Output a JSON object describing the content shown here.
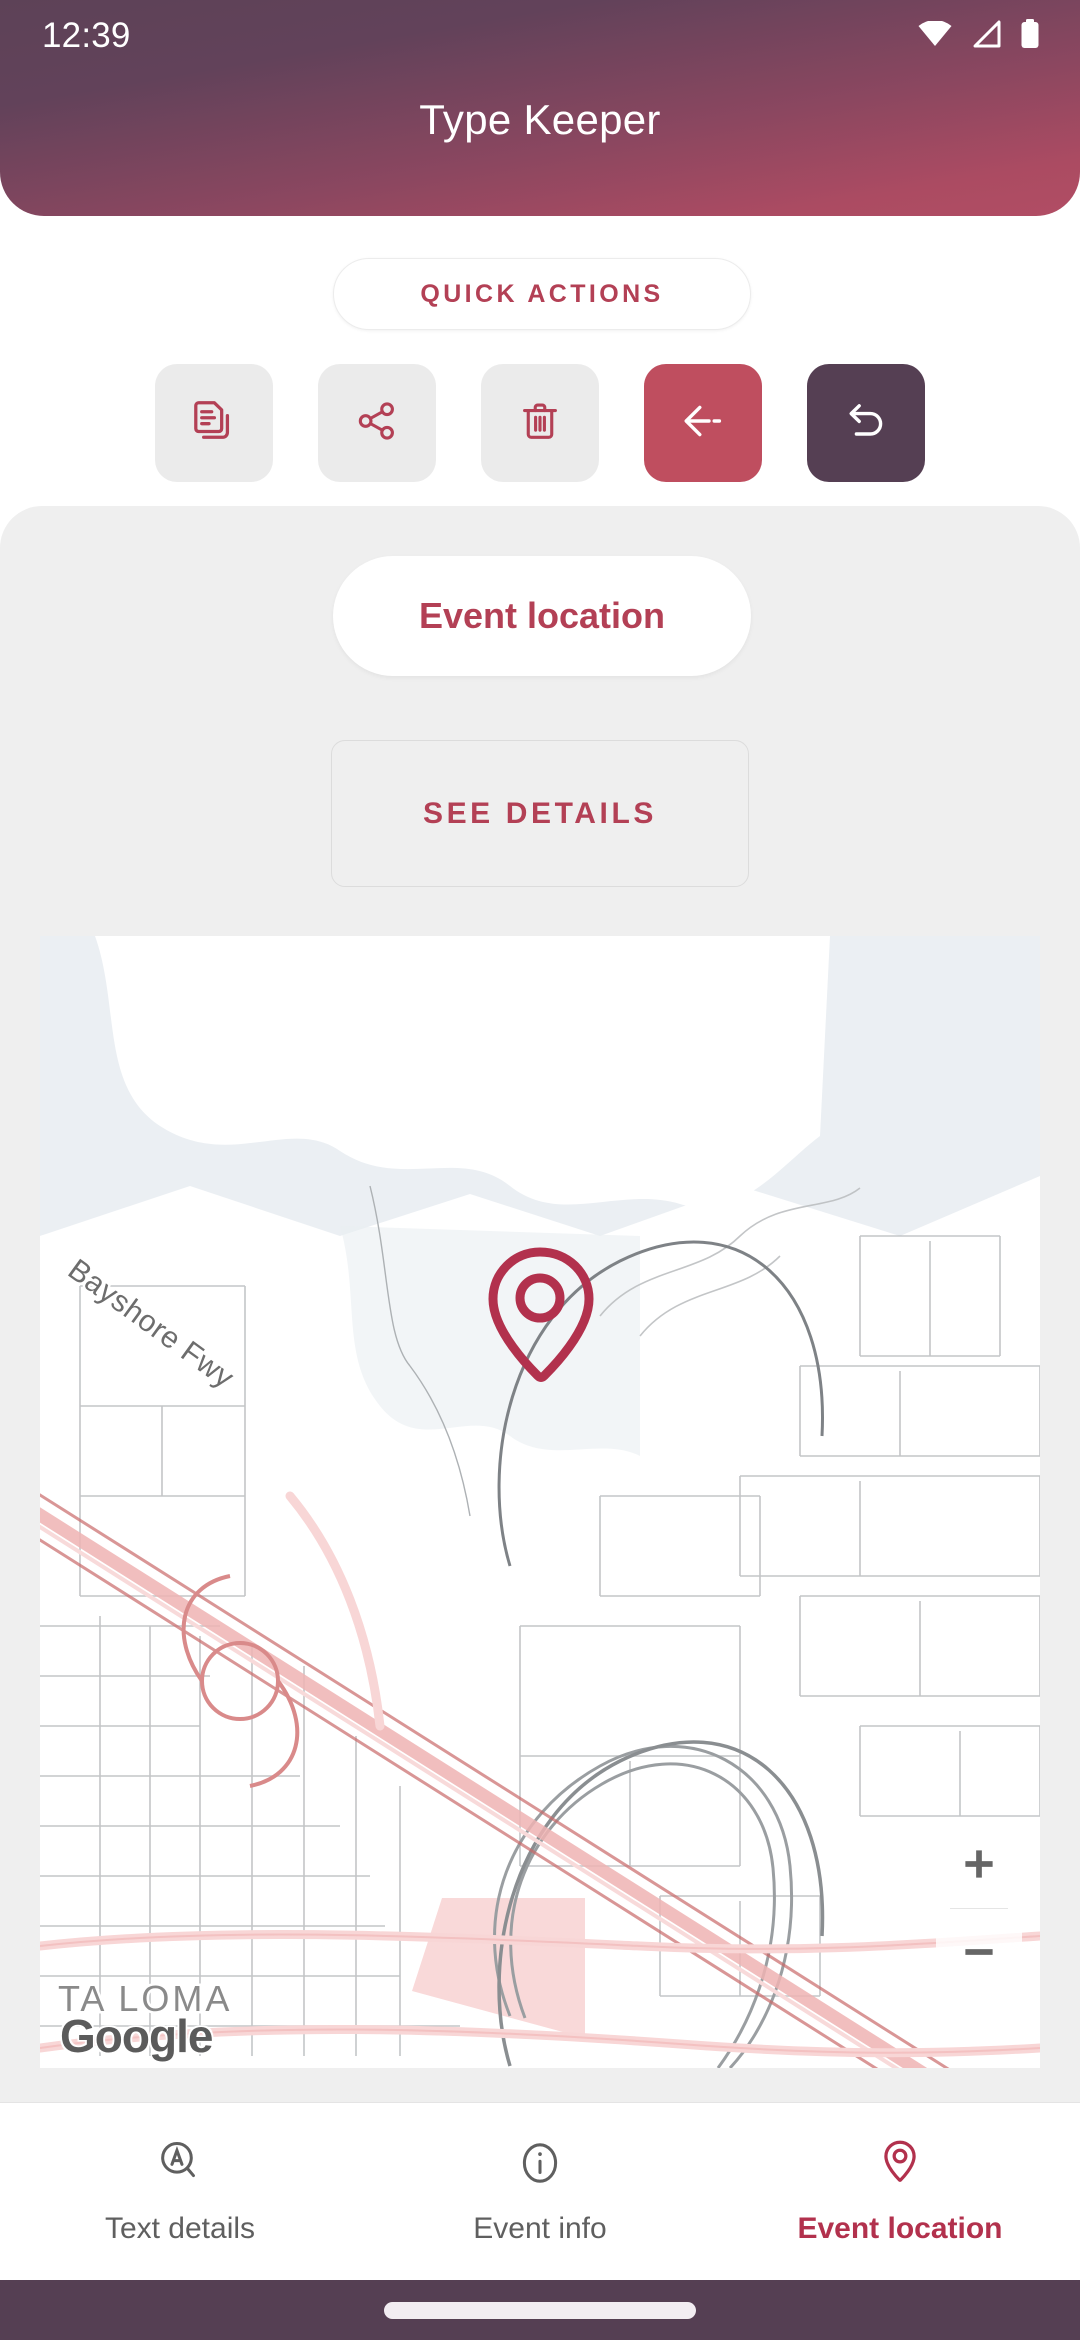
{
  "status_bar": {
    "time": "12:39",
    "icons": [
      "wifi-icon",
      "cellular-signal-icon",
      "battery-icon"
    ]
  },
  "app_bar": {
    "title": "Type Keeper",
    "gradient_from": "#5d4257",
    "gradient_to": "#b14d64"
  },
  "quick_actions": {
    "chip_label": "QUICK ACTIONS",
    "buttons": [
      {
        "name": "copy-icon",
        "label": "Copy",
        "bg": "#ebebeb",
        "fg": "#b34055"
      },
      {
        "name": "share-icon",
        "label": "Share",
        "bg": "#ebebeb",
        "fg": "#b34055"
      },
      {
        "name": "delete-icon",
        "label": "Delete",
        "bg": "#ebebeb",
        "fg": "#b34055"
      },
      {
        "name": "back-arrow-icon",
        "label": "Back",
        "bg": "#bf4e5f",
        "fg": "#ffffff"
      },
      {
        "name": "undo-icon",
        "label": "Undo",
        "bg": "#553f53",
        "fg": "#ffffff"
      }
    ]
  },
  "content": {
    "location_chip": "Event location",
    "see_details_button": "SEE DETAILS"
  },
  "map": {
    "attribution": "Google",
    "road_label": "Bayshore Fwy",
    "place_label": "TA LOMA",
    "marker": "map-pin-icon",
    "marker_color": "#b2314d",
    "zoom_in": "+",
    "zoom_out": "−"
  },
  "bottom_nav": {
    "items": [
      {
        "label": "Text details",
        "icon": "text-search-icon",
        "active": false
      },
      {
        "label": "Event info",
        "icon": "info-icon",
        "active": false
      },
      {
        "label": "Event location",
        "icon": "map-pin-icon",
        "active": true
      }
    ],
    "active_color": "#b2314d",
    "inactive_color": "#5f5f5f"
  },
  "theme": {
    "accent": "#b34055",
    "primary_dark": "#553f53",
    "sheet_bg": "#efefef"
  }
}
